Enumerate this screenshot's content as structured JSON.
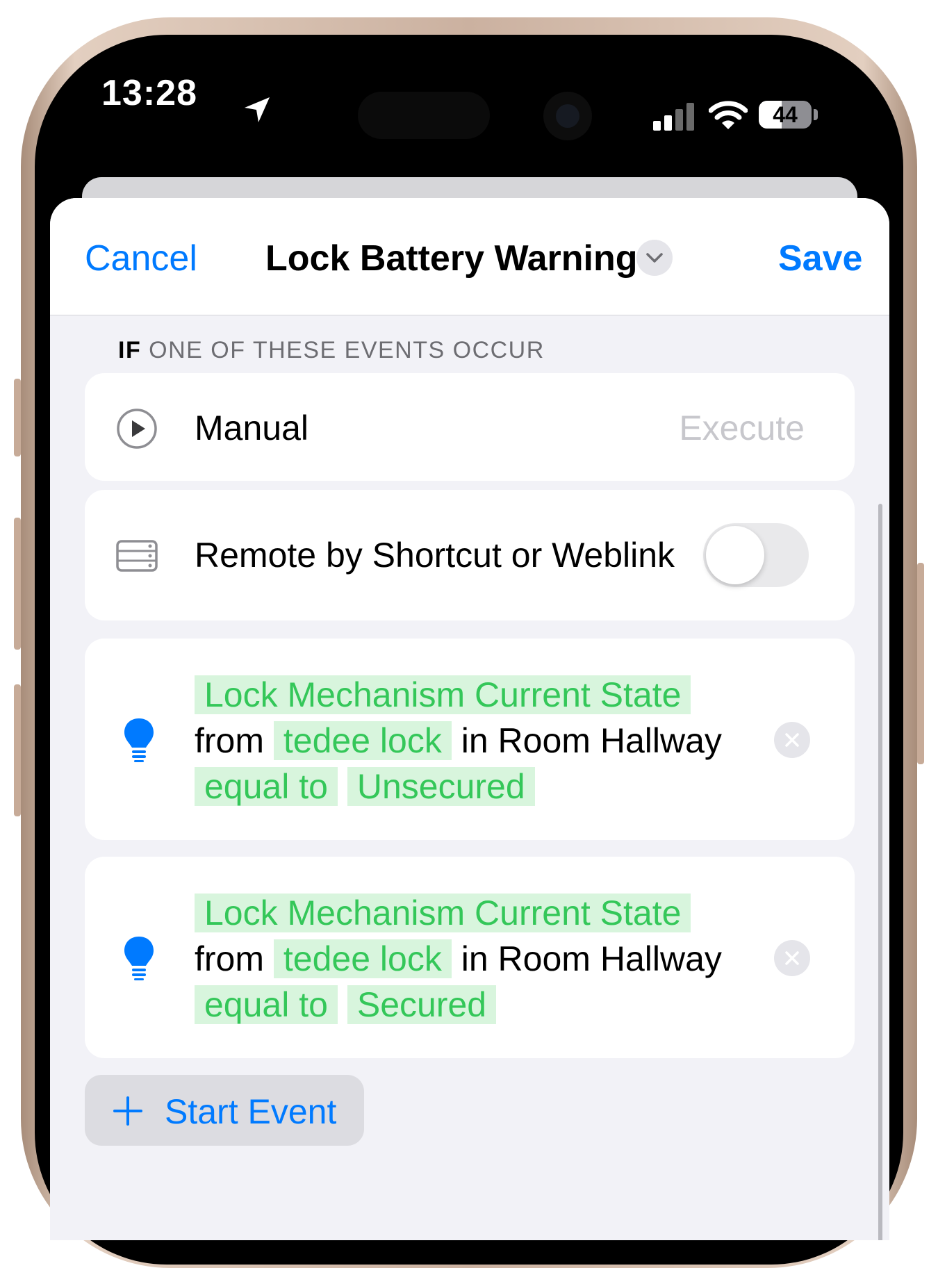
{
  "status_bar": {
    "time": "13:28",
    "battery_level": "44",
    "icons": [
      "location-arrow-icon",
      "cellular-signal-icon",
      "wifi-icon",
      "battery-icon"
    ]
  },
  "nav": {
    "cancel_label": "Cancel",
    "title": "Lock Battery Warning",
    "save_label": "Save",
    "title_menu_icon": "chevron-down-icon"
  },
  "section": {
    "header_prefix": "IF",
    "header_rest": "ONE OF THESE EVENTS OCCUR"
  },
  "triggers": {
    "manual": {
      "label": "Manual",
      "action": "Execute",
      "icon": "play-circle-icon"
    },
    "remote": {
      "label": "Remote by Shortcut or Weblink",
      "enabled": false,
      "icon": "server-icon"
    }
  },
  "conditions": [
    {
      "characteristic": "Lock Mechanism Current State",
      "from_text": "from",
      "device": "tedee lock",
      "room_text": "in Room",
      "room": "Hallway",
      "operator": "equal to",
      "value": "Unsecured",
      "icon": "lightbulb-icon"
    },
    {
      "characteristic": "Lock Mechanism Current State",
      "from_text": "from",
      "device": "tedee lock",
      "room_text": "in Room",
      "room": "Hallway",
      "operator": "equal to",
      "value": "Secured",
      "icon": "lightbulb-icon"
    }
  ],
  "actions": {
    "start_event_label": "Start Event"
  },
  "colors": {
    "accent": "#007aff",
    "pill_text": "#34c759",
    "pill_bg": "#d8f5dd",
    "background": "#f2f2f7"
  }
}
